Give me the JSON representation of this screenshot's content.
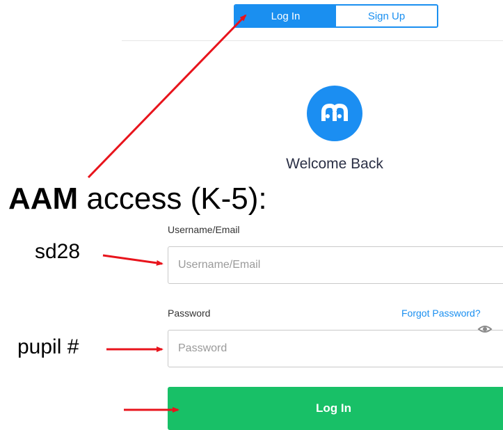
{
  "auth_tabs": {
    "login_label": "Log In",
    "signup_label": "Sign Up"
  },
  "welcome_text": "Welcome Back",
  "overlay": {
    "title_bold": "AAM",
    "title_rest": " access (K-5):"
  },
  "form": {
    "username_label": "Username/Email",
    "username_placeholder": "Username/Email",
    "password_label": "Password",
    "password_placeholder": "Password",
    "forgot_password": "Forgot Password?",
    "login_button": "Log In"
  },
  "annotations": {
    "username_hint": "sd28",
    "password_hint": "pupil #"
  },
  "icons": {
    "logo": "m-logo-icon",
    "show_password": "eye-icon"
  },
  "colors": {
    "accent": "#1a8ff0",
    "login_button": "#18c067",
    "arrow": "#e8141c"
  }
}
